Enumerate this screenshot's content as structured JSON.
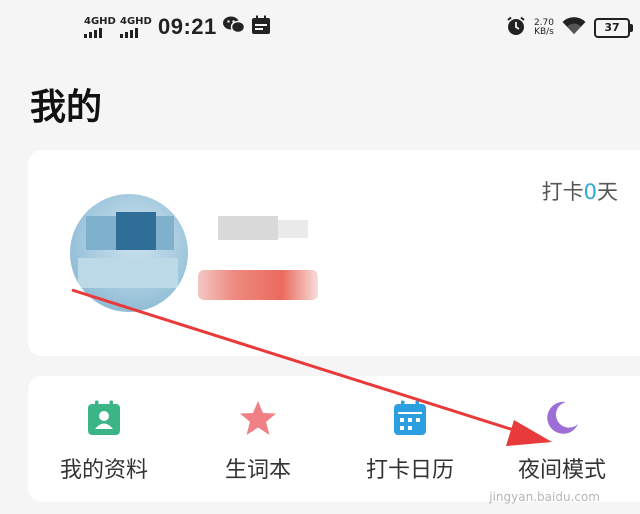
{
  "status_bar": {
    "sim1": "4GHD",
    "sim2": "4GHD",
    "time": "09:21",
    "net_speed_value": "2.70",
    "net_speed_unit": "KB/s",
    "battery": "37",
    "icons": [
      "signal-icon",
      "signal-icon",
      "wechat-icon",
      "calendar-notification-icon",
      "alarm-icon",
      "wifi-icon",
      "battery-icon"
    ]
  },
  "page": {
    "title": "我的"
  },
  "profile": {
    "checkin_prefix": "打卡",
    "checkin_days": "0",
    "checkin_suffix": "天",
    "avatar_icon": "avatar-icon"
  },
  "menu": {
    "items": [
      {
        "label": "我的资料",
        "icon": "profile-card-icon",
        "color": "#3bb585"
      },
      {
        "label": "生词本",
        "icon": "star-icon",
        "color": "#f07f86"
      },
      {
        "label": "打卡日历",
        "icon": "calendar-icon",
        "color": "#2b9fe0"
      },
      {
        "label": "夜间模式",
        "icon": "moon-icon",
        "color": "#9b6fd6"
      }
    ]
  },
  "annotation": {
    "arrow_color": "#e83a3a"
  },
  "watermark": "jingyan.baidu.com"
}
